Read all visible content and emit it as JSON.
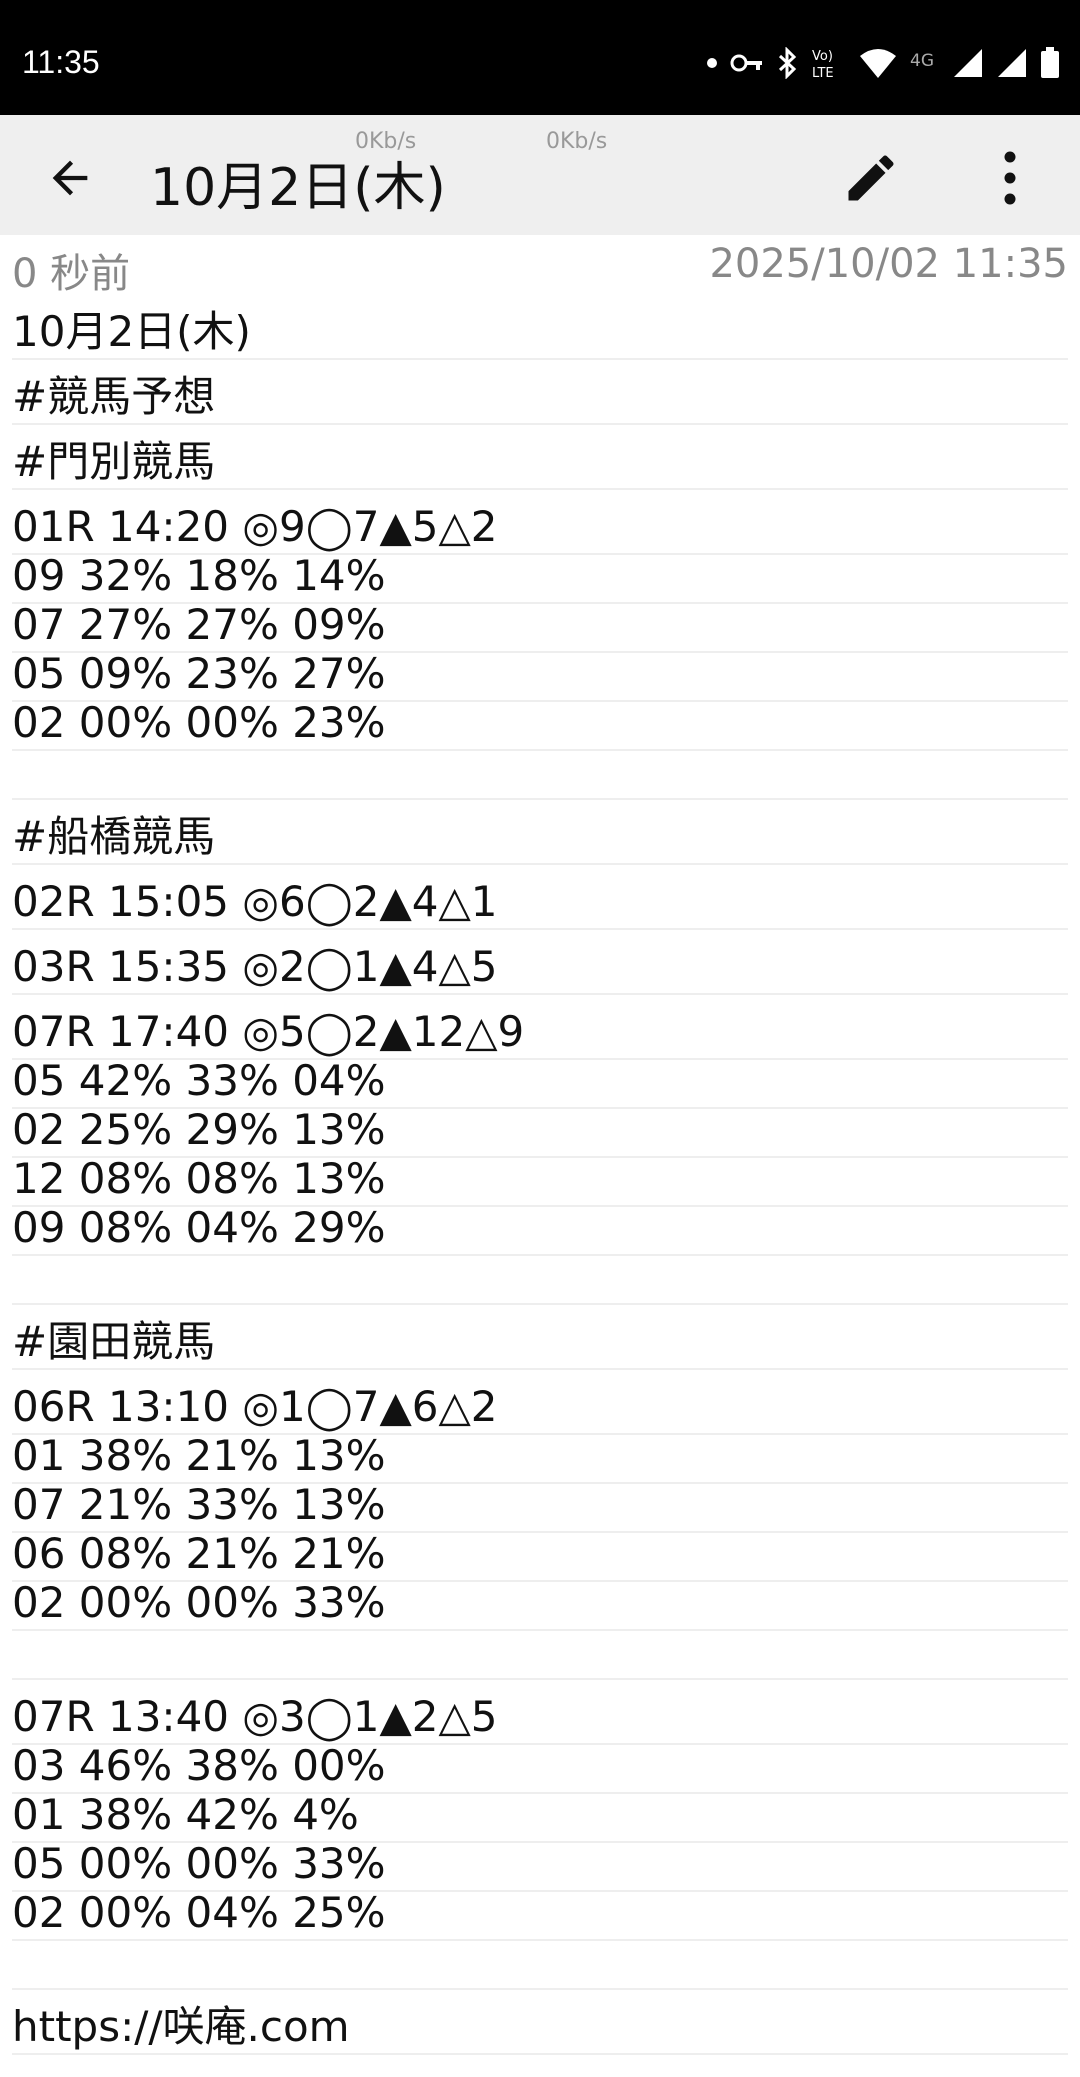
{
  "status_bar": {
    "time": "11:35",
    "icons": [
      "dot-icon",
      "vpn-key-icon",
      "bluetooth-icon",
      "volte-icon",
      "wifi-icon",
      "4g-icon",
      "signal-icon",
      "signal-icon",
      "battery-icon"
    ],
    "network_label": "4G",
    "volte_label": "Vo) LTE"
  },
  "app_bar": {
    "title": "10月2日(木)",
    "speed_left": "0Kb/s",
    "speed_right": "0Kb/s",
    "icons": [
      "back-arrow-icon",
      "edit-pencil-icon",
      "more-vert-icon"
    ]
  },
  "meta": {
    "relative_time": "0 秒前",
    "timestamp": "2025/10/02 11:35"
  },
  "note_lines": [
    "10月2日(木)",
    "#競馬予想",
    "#門別競馬",
    "01R 14:20 ◎9◯7▲5△2",
    "09 32% 18% 14%",
    "07 27% 27% 09%",
    "05 09% 23% 27%",
    "02 00% 00% 23%",
    "",
    "#船橋競馬",
    "02R 15:05 ◎6◯2▲4△1",
    "03R 15:35 ◎2◯1▲4△5",
    "07R 17:40 ◎5◯2▲12△9",
    "05 42% 33% 04%",
    "02 25% 29% 13%",
    "12 08% 08% 13%",
    "09 08% 04% 29%",
    "",
    "#園田競馬",
    "06R 13:10 ◎1◯7▲6△2",
    "01 38% 21% 13%",
    "07 21% 33% 13%",
    "06 08% 21% 21%",
    "02 00% 00% 33%",
    "",
    "07R 13:40 ◎3◯1▲2△5",
    "03 46% 38% 00%",
    "01 38% 42% 4%",
    "05 00% 00% 33%",
    "02 00% 04% 25%",
    "",
    "https://咲庵.com"
  ]
}
